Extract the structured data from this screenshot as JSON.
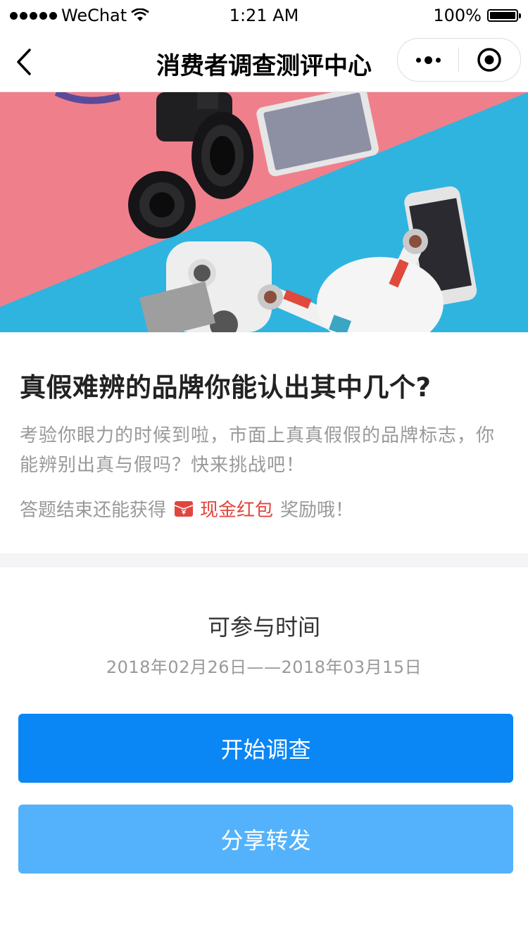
{
  "status_bar": {
    "carrier": "WeChat",
    "time": "1:21 AM",
    "battery": "100%"
  },
  "nav": {
    "title": "消费者调查测评中心"
  },
  "intro": {
    "headline": "真假难辨的品牌你能认出其中几个?",
    "description": "考验你眼力的时候到啦，市面上真真假假的品牌标志，你能辨别出真与假吗？快来挑战吧！",
    "reward_prefix": "答题结束还能获得",
    "reward_highlight": "现金红包",
    "reward_suffix": "奖励哦！"
  },
  "schedule": {
    "title": "可参与时间",
    "range": "2018年02月26日——2018年03月15日"
  },
  "buttons": {
    "start": "开始调查",
    "share": "分享转发"
  },
  "colors": {
    "primary": "#0a86f5",
    "secondary": "#53b2fb",
    "highlight": "#e0463d",
    "banner_pink": "#f07f8c",
    "banner_blue": "#2fb4df"
  },
  "icons": {
    "back": "chevron-left-icon",
    "more": "more-dots-icon",
    "close": "target-close-icon",
    "reward": "red-envelope-icon"
  }
}
